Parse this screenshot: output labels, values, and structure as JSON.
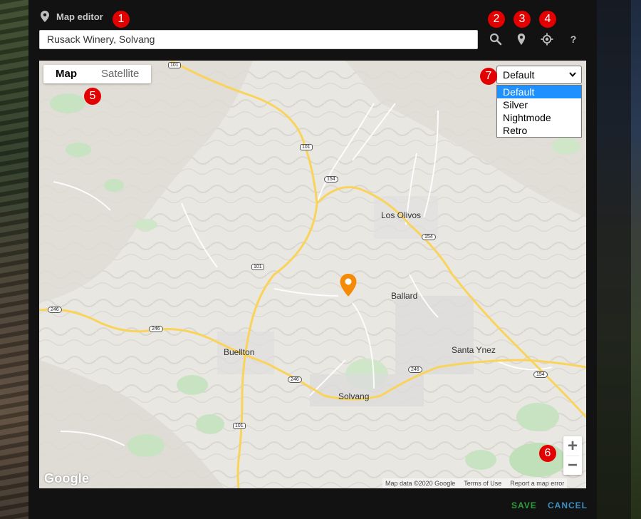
{
  "header": {
    "title": "Map editor"
  },
  "search": {
    "value": "Rusack Winery, Solvang"
  },
  "toolbar": {
    "help_label": "?"
  },
  "map_type": {
    "tabs": [
      "Map",
      "Satellite"
    ]
  },
  "style_select": {
    "selected": "Default",
    "options": [
      "Default",
      "Silver",
      "Nightmode",
      "Retro"
    ]
  },
  "places": {
    "los_olivos": "Los Olivos",
    "ballard": "Ballard",
    "buellton": "Buellton",
    "santa_ynez": "Santa Ynez",
    "solvang": "Solvang"
  },
  "route_shields": {
    "r101_a": "101",
    "r101_b": "101",
    "r101_c": "101",
    "r101_d": "101",
    "r154_a": "154",
    "r154_b": "154",
    "r154_c": "154",
    "r246_a": "246",
    "r246_b": "246",
    "r246_c": "246",
    "r246_d": "246"
  },
  "attribution": {
    "logo": "Google",
    "map_data": "Map data ©2020 Google",
    "terms": "Terms of Use",
    "report": "Report a map error"
  },
  "zoom": {
    "in": "+",
    "out": "−"
  },
  "footer": {
    "save": "SAVE",
    "cancel": "CANCEL"
  },
  "badges": [
    "1",
    "2",
    "3",
    "4",
    "5",
    "6",
    "7"
  ],
  "colors": {
    "accent_save": "#2e9e3e",
    "accent_cancel": "#3c8fc0",
    "badge": "#e30000",
    "marker": "#f58a07",
    "highway": "#f9d35a"
  }
}
